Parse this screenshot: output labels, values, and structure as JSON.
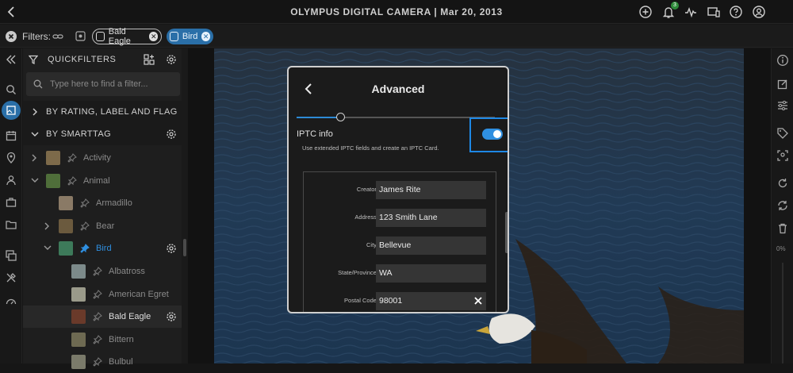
{
  "header": {
    "title": "OLYMPUS DIGITAL CAMERA | Mar 20, 2013",
    "notification_count": "3"
  },
  "filterbar": {
    "label": "Filters:",
    "chips": [
      {
        "label": "Bald Eagle",
        "style": "outlined"
      },
      {
        "label": "Bird",
        "style": "filled"
      }
    ]
  },
  "sidebar": {
    "title": "QUICKFILTERS",
    "search_placeholder": "Type here to find a filter...",
    "sections": [
      "BY RATING, LABEL AND FLAG",
      "BY SMARTTAG"
    ],
    "tree": [
      {
        "label": "Activity",
        "level": 1,
        "expander": "collapsed"
      },
      {
        "label": "Animal",
        "level": 1,
        "expander": "expanded"
      },
      {
        "label": "Armadillo",
        "level": 2,
        "expander": "none"
      },
      {
        "label": "Bear",
        "level": 2,
        "expander": "collapsed"
      },
      {
        "label": "Bird",
        "level": 2,
        "expander": "expanded",
        "active": true
      },
      {
        "label": "Albatross",
        "level": 3,
        "expander": "none"
      },
      {
        "label": "American Egret",
        "level": 3,
        "expander": "none"
      },
      {
        "label": "Bald Eagle",
        "level": 3,
        "expander": "none",
        "selected": true
      },
      {
        "label": "Bittern",
        "level": 3,
        "expander": "none"
      },
      {
        "label": "Bulbul",
        "level": 3,
        "expander": "none"
      }
    ]
  },
  "modal": {
    "title": "Advanced",
    "slider_value": 0.22,
    "iptc_label": "IPTC info",
    "iptc_description": "Use extended IPTC fields and create an IPTC Card.",
    "iptc_enabled": true,
    "fields": [
      {
        "label": "Creator:",
        "value": "James Rite"
      },
      {
        "label": "Address:",
        "value": "123 Smith Lane"
      },
      {
        "label": "City:",
        "value": "Bellevue"
      },
      {
        "label": "State/Province:",
        "value": "WA"
      },
      {
        "label": "Postal Code:",
        "value": "98001"
      }
    ]
  },
  "rightrail": {
    "zoom_label": "0%"
  },
  "colors": {
    "accent": "#2f8fe0",
    "focus_ring": "#1e88e5",
    "chip_blue": "#2a6fa8"
  }
}
